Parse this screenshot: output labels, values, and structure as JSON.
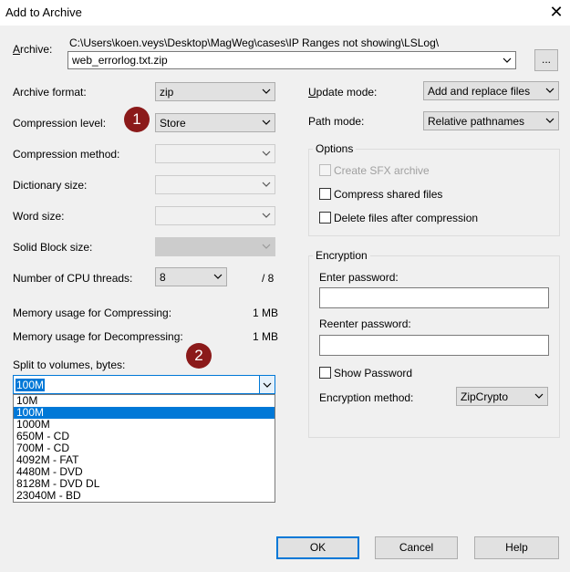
{
  "window": {
    "title": "Add to Archive",
    "close_glyph": "✕"
  },
  "archive": {
    "label": "Archive:",
    "path": "C:\\Users\\koen.veys\\Desktop\\MagWeg\\cases\\IP Ranges not showing\\LSLog\\",
    "filename": "web_errorlog.txt.zip",
    "browse_label": "..."
  },
  "left": {
    "archive_format": {
      "label": "Archive format:",
      "value": "zip"
    },
    "compression_level": {
      "label": "Compression level:",
      "value": "Store"
    },
    "compression_method": {
      "label": "Compression method:",
      "value": ""
    },
    "dictionary_size": {
      "label": "Dictionary size:",
      "value": ""
    },
    "word_size": {
      "label": "Word size:",
      "value": ""
    },
    "solid_block_size": {
      "label": "Solid Block size:",
      "value": ""
    },
    "cpu_threads": {
      "label": "Number of CPU threads:",
      "value": "8",
      "max": "/ 8"
    },
    "memory_compress": {
      "label": "Memory usage for Compressing:",
      "value": "1 MB"
    },
    "memory_decompress": {
      "label": "Memory usage for Decompressing:",
      "value": "1 MB"
    },
    "split": {
      "label": "Split to volumes, bytes:",
      "value": "100M",
      "options": [
        "10M",
        "100M",
        "1000M",
        "650M - CD",
        "700M - CD",
        "4092M - FAT",
        "4480M - DVD",
        "8128M - DVD DL",
        "23040M - BD"
      ],
      "selected_index": 1
    }
  },
  "right": {
    "update_mode": {
      "label": "Update mode:",
      "value": "Add and replace files"
    },
    "path_mode": {
      "label": "Path mode:",
      "value": "Relative pathnames"
    },
    "options": {
      "title": "Options",
      "create_sfx": "Create SFX archive",
      "compress_shared": "Compress shared files",
      "delete_after": "Delete files after compression"
    },
    "encryption": {
      "title": "Encryption",
      "enter_password": "Enter password:",
      "reenter_password": "Reenter password:",
      "show_password": "Show Password",
      "method_label": "Encryption method:",
      "method_value": "ZipCrypto"
    }
  },
  "buttons": {
    "ok": "OK",
    "cancel": "Cancel",
    "help": "Help"
  },
  "badges": {
    "one": "1",
    "two": "2"
  },
  "colors": {
    "accent": "#0078d7",
    "badge": "#8b1a1a"
  }
}
